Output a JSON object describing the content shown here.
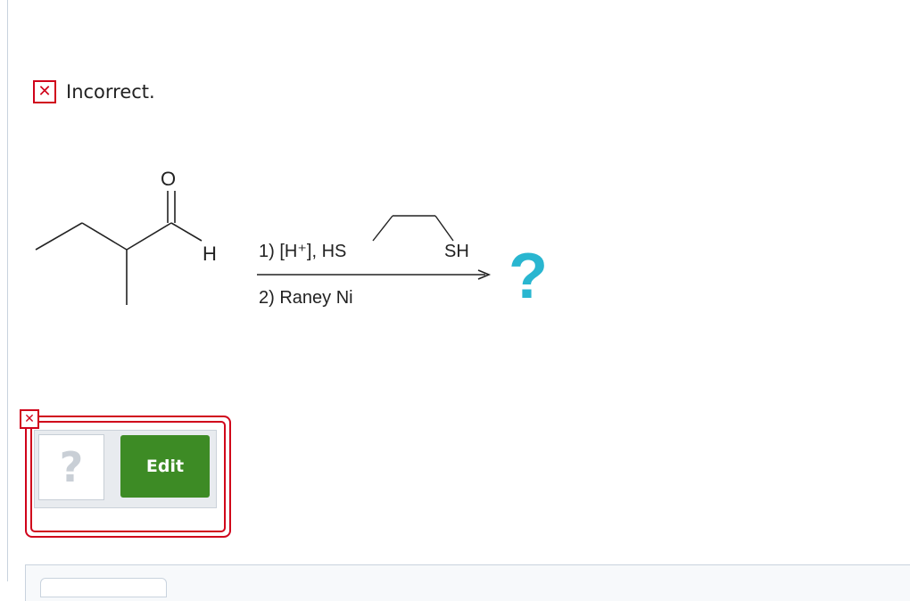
{
  "status": {
    "icon": "x-mark-icon",
    "icon_glyph": "✕",
    "text": "Incorrect.",
    "color": "#d0021b"
  },
  "reaction": {
    "atom_O": "O",
    "atom_H": "H",
    "step1": "1) [H⁺], HS",
    "thiol_SH": "SH",
    "step2": "2) Raney Ni",
    "product_placeholder": "?",
    "product_color": "#29b6d0"
  },
  "answer": {
    "slot_placeholder": "?",
    "edit_label": "Edit",
    "edit_color": "#3d8b25",
    "corner_glyph": "✕"
  }
}
